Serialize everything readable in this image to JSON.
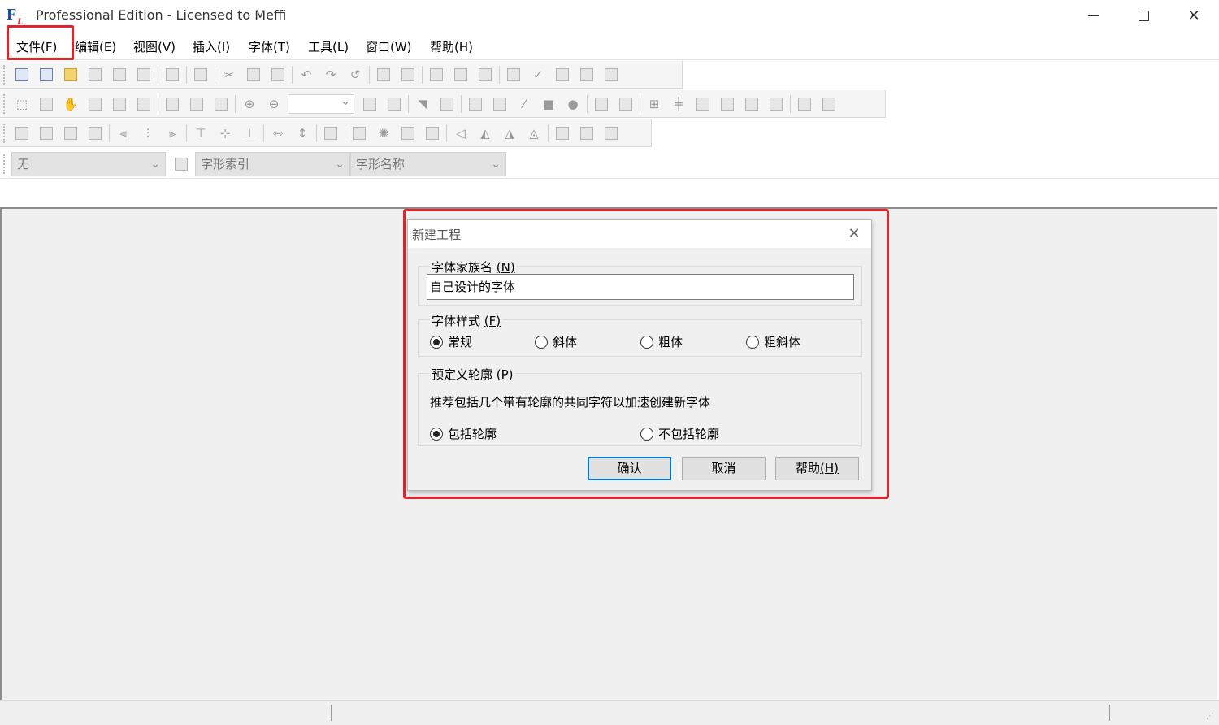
{
  "window": {
    "title": "Professional Edition - Licensed to Meffi",
    "logo_letter": "F",
    "logo_sub": "L"
  },
  "menu": {
    "items": [
      "文件(F)",
      "编辑(E)",
      "视图(V)",
      "插入(I)",
      "字体(T)",
      "工具(L)",
      "窗口(W)",
      "帮助(H)"
    ]
  },
  "toolbar": {
    "glyph_combo": "无",
    "glyph_index": "字形索引",
    "glyph_name": "字形名称"
  },
  "dialog": {
    "title": "新建工程",
    "family_group": {
      "label": "字体家族名 ",
      "hotkey": "(N)",
      "value": "自己设计的字体"
    },
    "style_group": {
      "label": "字体样式 ",
      "hotkey": "(F)",
      "options": [
        "常规",
        "斜体",
        "粗体",
        "粗斜体"
      ],
      "selected": "常规"
    },
    "outline_group": {
      "label": "预定义轮廓 ",
      "hotkey": "(P)",
      "description": "推荐包括几个带有轮廓的共同字符以加速创建新字体",
      "options": [
        "包括轮廓",
        "不包括轮廓"
      ],
      "selected": "包括轮廓"
    },
    "buttons": {
      "ok": "确认",
      "cancel": "取消",
      "help_label": "帮助",
      "help_hotkey": "(H)"
    }
  },
  "colors": {
    "highlight": "#e0262a",
    "default_button_border": "#0078d7"
  }
}
